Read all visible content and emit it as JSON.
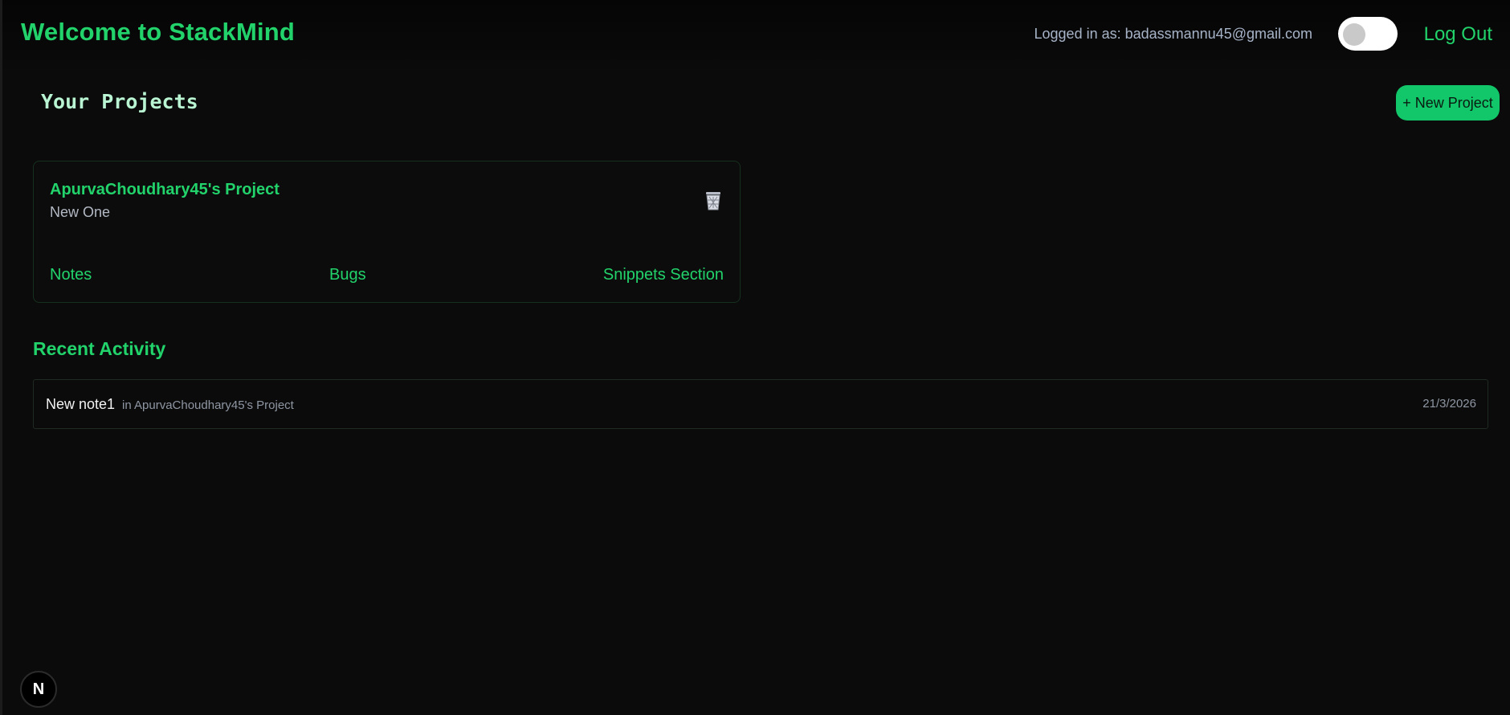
{
  "header": {
    "title": "Welcome to StackMind",
    "logged_in_text": "Logged in as: badassmannu45@gmail.com",
    "theme_toggle_state": "off",
    "logout_label": "Log Out"
  },
  "projects": {
    "heading": "Your Projects",
    "new_button_label": "+ New Project",
    "items": [
      {
        "name": "ApurvaChoudhary45's Project",
        "description": "New One",
        "links": {
          "notes": "Notes",
          "bugs": "Bugs",
          "snippets": "Snippets Section"
        },
        "delete_icon": "trash-icon"
      }
    ]
  },
  "recent_activity": {
    "heading": "Recent Activity",
    "items": [
      {
        "title": "New note1",
        "context": "in ApurvaChoudhary45's Project",
        "date": "21/3/2026"
      }
    ]
  },
  "badge": {
    "letter": "N",
    "icon": "nextjs-logo-icon"
  },
  "colors": {
    "background": "#0b0b0b",
    "accent": "#22d36b",
    "button": "#11c76a",
    "muted_text": "#8f97a3"
  }
}
